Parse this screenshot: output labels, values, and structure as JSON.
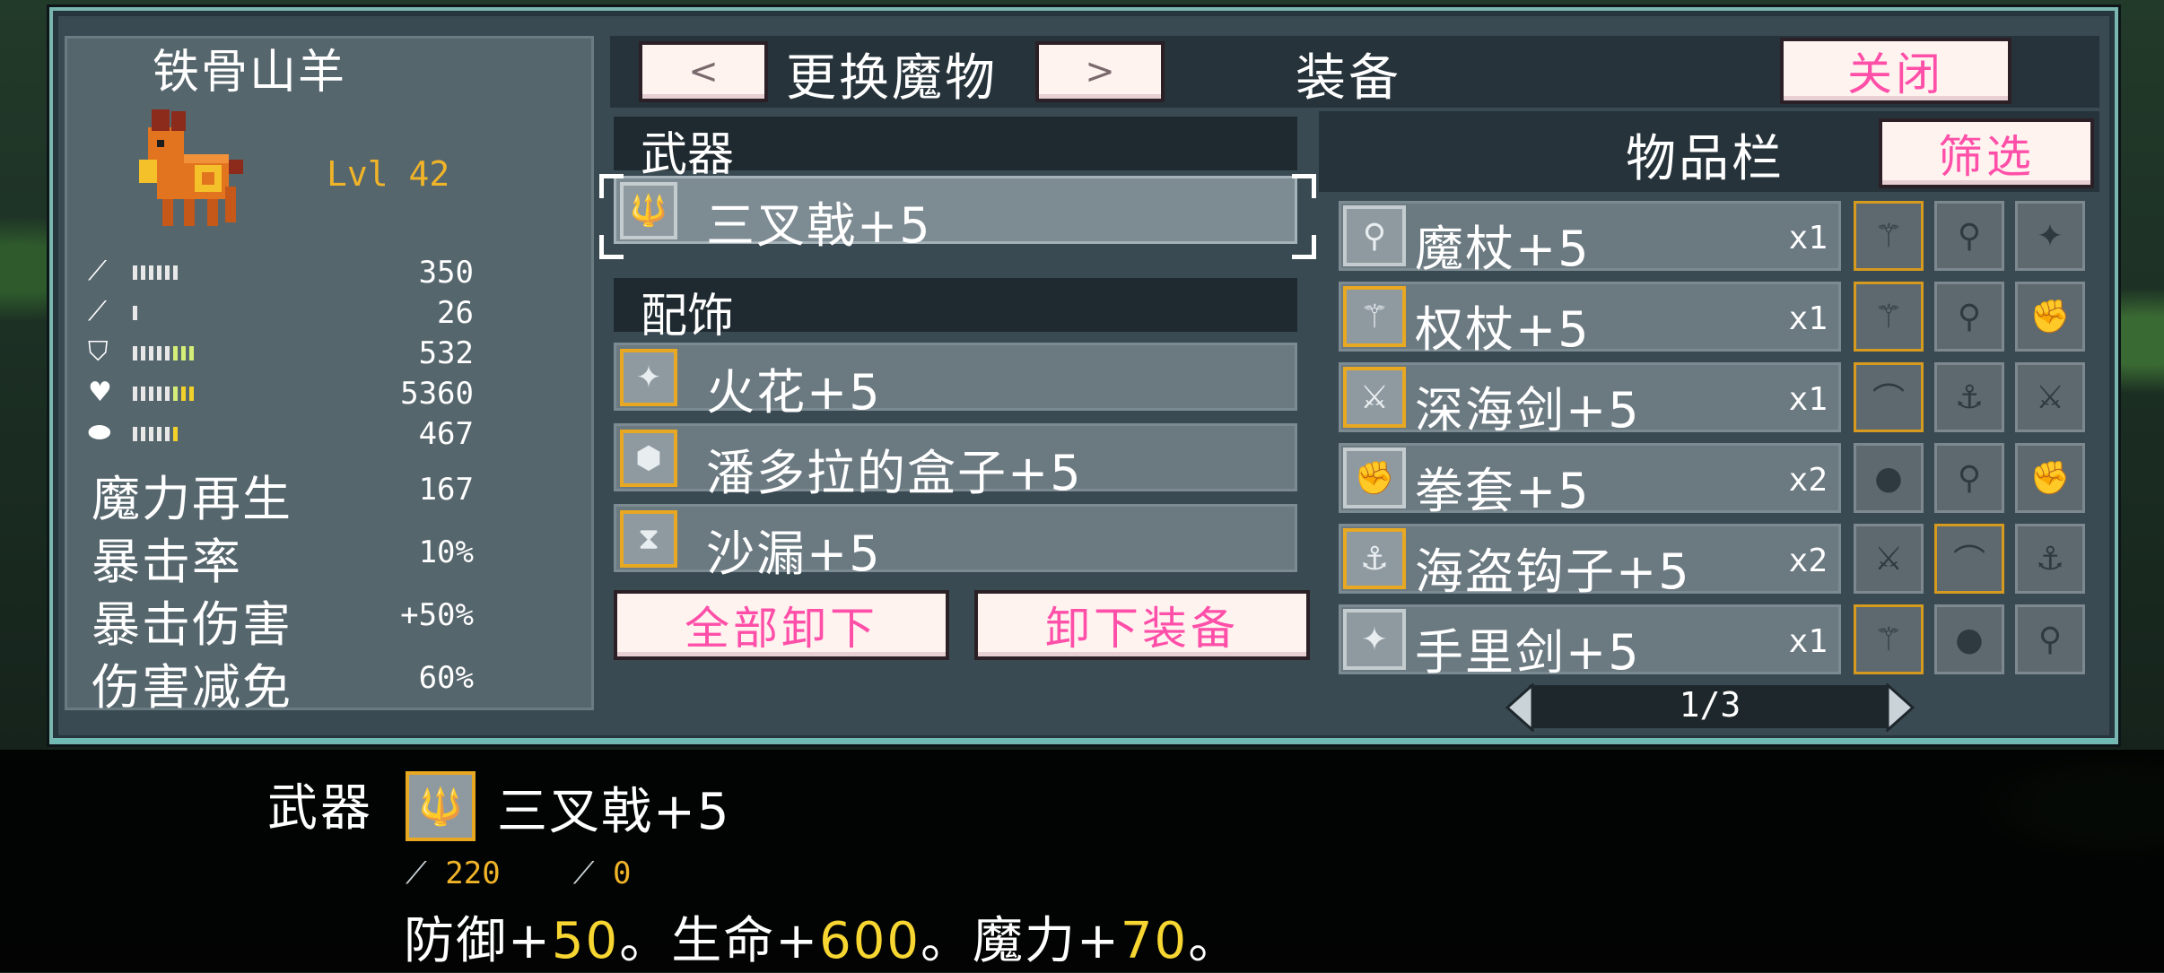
{
  "monster": {
    "name": "铁骨山羊",
    "level": "Lvl 42",
    "stats": [
      {
        "icon": "sword-icon",
        "value": "350",
        "bars": 6,
        "greens": 0,
        "yellows": 0
      },
      {
        "icon": "wand-icon",
        "value": "26",
        "bars": 1,
        "greens": 0,
        "yellows": 0
      },
      {
        "icon": "shield-icon",
        "value": "532",
        "bars": 5,
        "greens": 3,
        "yellows": 0
      },
      {
        "icon": "heart-icon",
        "value": "5360",
        "bars": 5,
        "greens": 1,
        "yellows": 2
      },
      {
        "icon": "mana-icon",
        "value": "467",
        "bars": 5,
        "greens": 0,
        "yellows": 1
      }
    ],
    "text_stats": [
      {
        "label": "魔力再生",
        "value": "167"
      },
      {
        "label": "暴击率",
        "value": "10%"
      },
      {
        "label": "暴击伤害",
        "value": "+50%"
      },
      {
        "label": "伤害减免",
        "value": "60%"
      }
    ]
  },
  "header": {
    "prev_label": "<",
    "change_label": "更换魔物",
    "next_label": ">",
    "equipment_label": "装备",
    "close_label": "关闭"
  },
  "equipment": {
    "weapon_header": "武器",
    "weapon": {
      "name": "三叉戟+5",
      "icon": "trident-icon"
    },
    "accessory_header": "配饰",
    "accessories": [
      {
        "name": "火花+5",
        "icon": "spark-icon"
      },
      {
        "name": "潘多拉的盒子+5",
        "icon": "box-icon"
      },
      {
        "name": "沙漏+5",
        "icon": "hourglass-icon"
      }
    ],
    "unequip_all_label": "全部卸下",
    "unequip_label": "卸下装备"
  },
  "inventory": {
    "header": "物品栏",
    "filter_label": "筛选",
    "items": [
      {
        "name": "魔杖+5",
        "count": "x1",
        "icon": "wand-icon",
        "gold": false
      },
      {
        "name": "权杖+5",
        "count": "x1",
        "icon": "scepter-icon",
        "gold": true
      },
      {
        "name": "深海剑+5",
        "count": "x1",
        "icon": "sword-icon",
        "gold": true
      },
      {
        "name": "拳套+5",
        "count": "x2",
        "icon": "gauntlet-icon",
        "gold": false
      },
      {
        "name": "海盗钩子+5",
        "count": "x2",
        "icon": "hook-icon",
        "gold": true
      },
      {
        "name": "手里剑+5",
        "count": "x1",
        "icon": "shuriken-icon",
        "gold": false
      }
    ],
    "page": "1/3"
  },
  "description": {
    "slot_label": "武器",
    "item_name": "三叉戟+5",
    "attack": "220",
    "magic": "0",
    "effect_defense_label": "防御+",
    "effect_defense": "50",
    "effect_hp_label": "。生命+",
    "effect_hp": "600",
    "effect_mp_label": "。魔力+",
    "effect_mp": "70",
    "effect_end": "。"
  },
  "colors": {
    "accent_pink": "#ff4fa8",
    "gold_border": "#e8a822",
    "frame_teal": "#79b7b0",
    "level_gold": "#f0b429"
  }
}
